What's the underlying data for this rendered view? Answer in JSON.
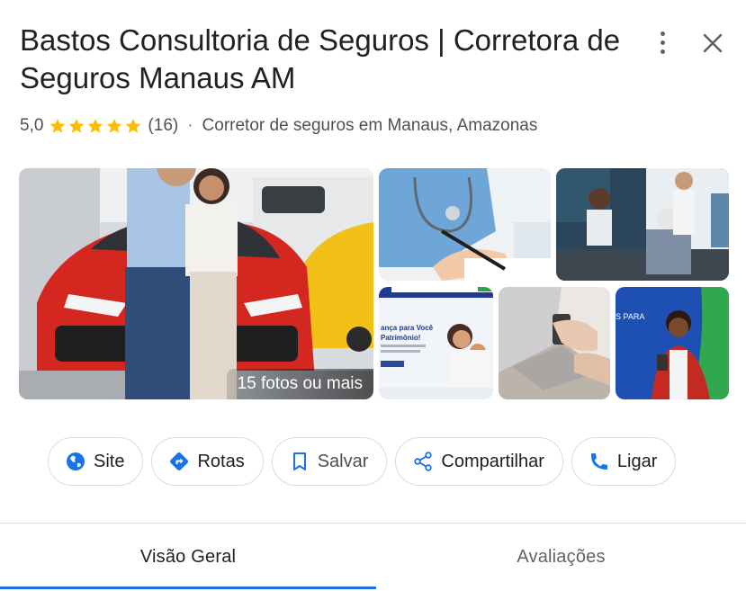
{
  "business": {
    "title": "Bastos Consultoria de Seguros | Corretora de Seguros Manaus AM",
    "rating": "5,0",
    "review_count": "(16)",
    "separator": "·",
    "category": "Corretor de seguros em Manaus, Amazonas",
    "stars": 5
  },
  "photos": {
    "more_label": "15 fotos ou mais",
    "website_banner_text": "ança para Você Patrimônio!",
    "promo_text": "S PARA"
  },
  "actions": [
    {
      "label": "Site",
      "icon": "globe-icon"
    },
    {
      "label": "Rotas",
      "icon": "directions-icon"
    },
    {
      "label": "Salvar",
      "icon": "bookmark-icon"
    },
    {
      "label": "Compartilhar",
      "icon": "share-icon"
    },
    {
      "label": "Ligar",
      "icon": "phone-icon"
    }
  ],
  "tabs": [
    {
      "label": "Visão Geral",
      "active": true
    },
    {
      "label": "Avaliações",
      "active": false
    }
  ],
  "colors": {
    "accent": "#1a73e8",
    "star": "#fbbc04",
    "text": "#202124"
  }
}
